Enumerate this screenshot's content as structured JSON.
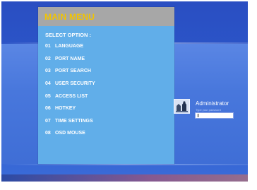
{
  "menu": {
    "title": "MAIN MENU",
    "select_label": "SELECT OPTION :",
    "items": [
      {
        "num": "01",
        "label": "LANGUAGE"
      },
      {
        "num": "02",
        "label": "PORT NAME"
      },
      {
        "num": "03",
        "label": "PORT SEARCH"
      },
      {
        "num": "04",
        "label": "USER SECURITY"
      },
      {
        "num": "05",
        "label": "ACCESS LIST"
      },
      {
        "num": "06",
        "label": "HOTKEY"
      },
      {
        "num": "07",
        "label": "TIME SETTINGS"
      },
      {
        "num": "08",
        "label": "OSD MOUSE"
      }
    ]
  },
  "login": {
    "user_name": "Administrator",
    "password_hint": "Type your password",
    "password_value": ""
  },
  "colors": {
    "menu_bg": "#61aee9",
    "menu_header_bg": "#a7a7a7",
    "title_color": "#f2c400",
    "desktop_blue": "#2b55c8"
  }
}
